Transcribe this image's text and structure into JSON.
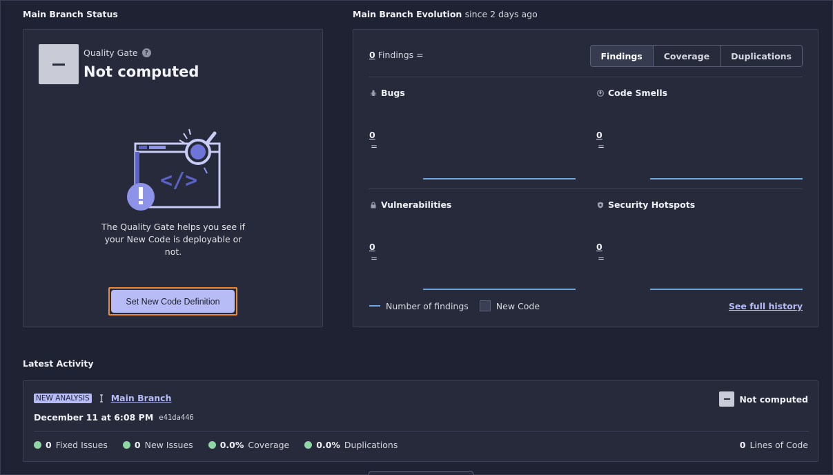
{
  "status": {
    "title": "Main Branch Status",
    "quality_gate_label": "Quality Gate",
    "quality_gate_value": "Not computed",
    "help_glyph": "?",
    "description": "The Quality Gate helps you see if your New Code is deployable or not.",
    "button_label": "Set New Code Definition"
  },
  "evolution": {
    "title": "Main Branch Evolution",
    "since": "since 2 days ago",
    "findings_count": "0",
    "findings_label": "Findings",
    "findings_eq": "=",
    "tabs": [
      {
        "label": "Findings",
        "active": true
      },
      {
        "label": "Coverage",
        "active": false
      },
      {
        "label": "Duplications",
        "active": false
      }
    ],
    "metrics": [
      {
        "label": "Bugs",
        "icon": "bug-icon",
        "value": "0",
        "eq": "="
      },
      {
        "label": "Code Smells",
        "icon": "code-smell-icon",
        "value": "0",
        "eq": "="
      },
      {
        "label": "Vulnerabilities",
        "icon": "lock-icon",
        "value": "0",
        "eq": "="
      },
      {
        "label": "Security Hotspots",
        "icon": "shield-icon",
        "value": "0",
        "eq": "="
      }
    ],
    "legend_findings": "Number of findings",
    "legend_new_code": "New Code",
    "see_history": "See full history"
  },
  "activity": {
    "title": "Latest Activity",
    "badge": "NEW ANALYSIS",
    "branch": "Main Branch",
    "date": "December 11 at 6:08 PM",
    "hash": "e41da446",
    "gate_status": "Not computed",
    "stats": [
      {
        "value": "0",
        "label": "Fixed Issues"
      },
      {
        "value": "0",
        "label": "New Issues"
      },
      {
        "value": "0.0%",
        "label": "Coverage"
      },
      {
        "value": "0.0%",
        "label": "Duplications"
      }
    ],
    "loc_value": "0",
    "loc_label": "Lines of Code"
  },
  "colors": {
    "background": "#1f2233",
    "card": "#262a3b",
    "accent": "#b7bcf6",
    "sparkline": "#6aa7dd",
    "success_dot": "#8ed6a4",
    "focus_outline": "#ef8a2f"
  }
}
